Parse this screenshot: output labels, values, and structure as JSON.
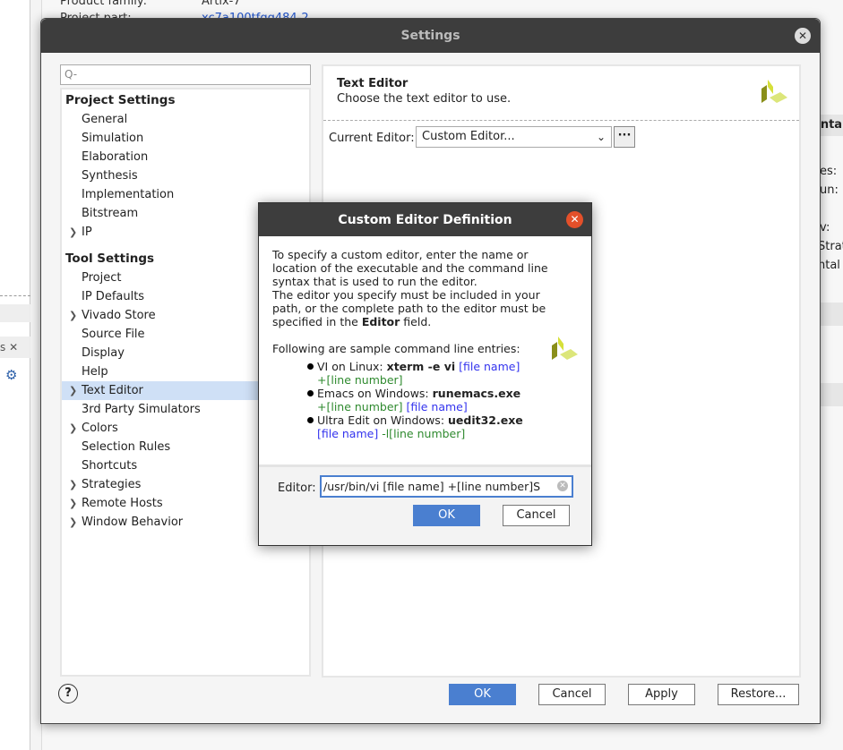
{
  "background": {
    "product_family_label": "Product family:",
    "product_family_value": "Artix-7",
    "project_part_label": "Project part:",
    "project_part_value": "xc7a100tfgg484-2",
    "right_fragments": [
      "enta",
      "es:",
      "un:",
      "v:",
      "Strat",
      "ntal"
    ],
    "left_tab_close": "s  ✕"
  },
  "settings": {
    "title": "Settings",
    "search_placeholder": "Q-",
    "tree": [
      {
        "label": "Project Settings",
        "type": "header"
      },
      {
        "label": "General"
      },
      {
        "label": "Simulation"
      },
      {
        "label": "Elaboration"
      },
      {
        "label": "Synthesis"
      },
      {
        "label": "Implementation"
      },
      {
        "label": "Bitstream"
      },
      {
        "label": "IP",
        "expandable": true
      },
      {
        "label": "Tool Settings",
        "type": "header"
      },
      {
        "label": "Project"
      },
      {
        "label": "IP Defaults"
      },
      {
        "label": "Vivado Store",
        "expandable": true
      },
      {
        "label": "Source File"
      },
      {
        "label": "Display"
      },
      {
        "label": "Help"
      },
      {
        "label": "Text Editor",
        "expandable": true,
        "selected": true
      },
      {
        "label": "3rd Party Simulators"
      },
      {
        "label": "Colors",
        "expandable": true
      },
      {
        "label": "Selection Rules"
      },
      {
        "label": "Shortcuts"
      },
      {
        "label": "Strategies",
        "expandable": true
      },
      {
        "label": "Remote Hosts",
        "expandable": true
      },
      {
        "label": "Window Behavior",
        "expandable": true
      }
    ],
    "panel": {
      "title": "Text Editor",
      "subtitle": "Choose the text editor to use.",
      "current_editor_label": "Current Editor:",
      "current_editor_value": "Custom Editor...",
      "more_button": "···"
    },
    "buttons": {
      "help": "?",
      "ok": "OK",
      "cancel": "Cancel",
      "apply": "Apply",
      "restore": "Restore..."
    }
  },
  "custom_editor": {
    "title": "Custom Editor Definition",
    "description_1": "To specify a custom editor, enter the name or location of the executable and the command line syntax that is used to run the editor.",
    "description_2a": "The editor you specify must be included in your path, or the complete path to the editor must be specified in the ",
    "description_2b": "Editor",
    "description_2c": " field.",
    "samples_heading": "Following are sample command line entries:",
    "samples": [
      {
        "label": "VI on Linux: ",
        "cmd": "xterm -e vi",
        "a": "[file name]",
        "b": "+[line number]"
      },
      {
        "label": "Emacs on Windows: ",
        "cmd": "runemacs.exe",
        "a": "+[line number]",
        "b": "[file name]"
      },
      {
        "label": "Ultra Edit on Windows: ",
        "cmd": "uedit32.exe",
        "a": "[file name]",
        "b": "-l[line number]"
      }
    ],
    "editor_label": "Editor:",
    "editor_value": "/usr/bin/vi [file name] +[line number]S",
    "ok": "OK",
    "cancel": "Cancel"
  },
  "colors": {
    "accent": "#4a7fd0",
    "selection": "#cfe0f6",
    "titlebar": "#3d3d3d",
    "close_red": "#e4502a",
    "link_blue": "#3333ee",
    "green": "#2f8a2f"
  }
}
